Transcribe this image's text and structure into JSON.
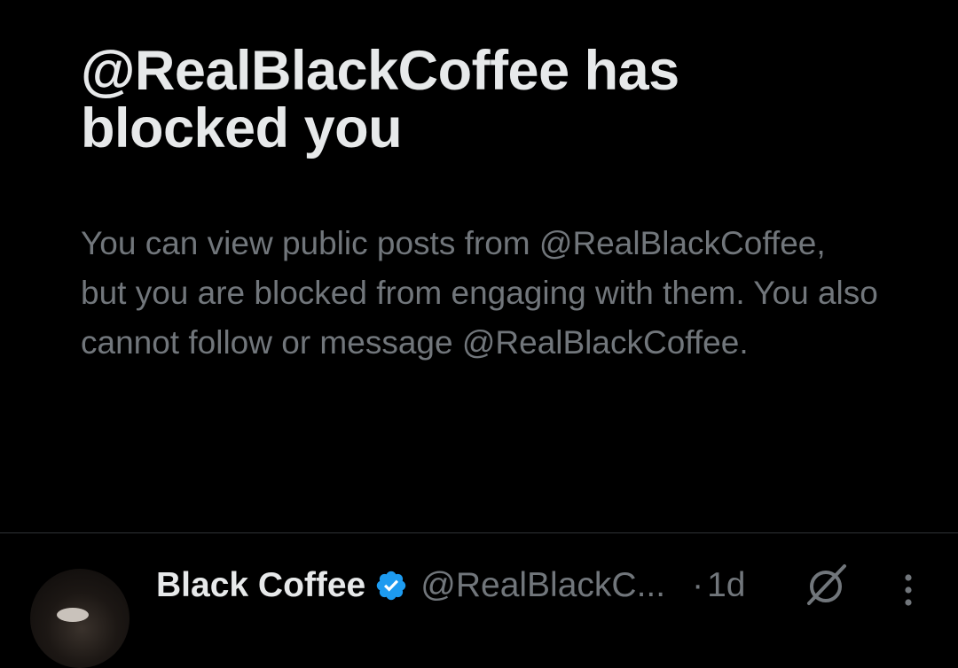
{
  "blocked_notice": {
    "title": "@RealBlackCoffee has blocked you",
    "description": "You can view public posts from @RealBlackCoffee, but you are blocked from engaging with them. You also cannot follow or message @RealBlackCoffee."
  },
  "post": {
    "display_name": "Black Coffee",
    "handle": "@RealBlackC...",
    "separator": "·",
    "timestamp": "1d",
    "verified": true,
    "icons": {
      "verified": "verified-badge-icon",
      "reply_restricted": "slashed-circle-icon",
      "more": "more-vertical-icon"
    }
  },
  "colors": {
    "background": "#000000",
    "primary_text": "#e7e9ea",
    "secondary_text": "#71767b",
    "verified_blue": "#1d9bf0",
    "divider": "#2f3336"
  }
}
